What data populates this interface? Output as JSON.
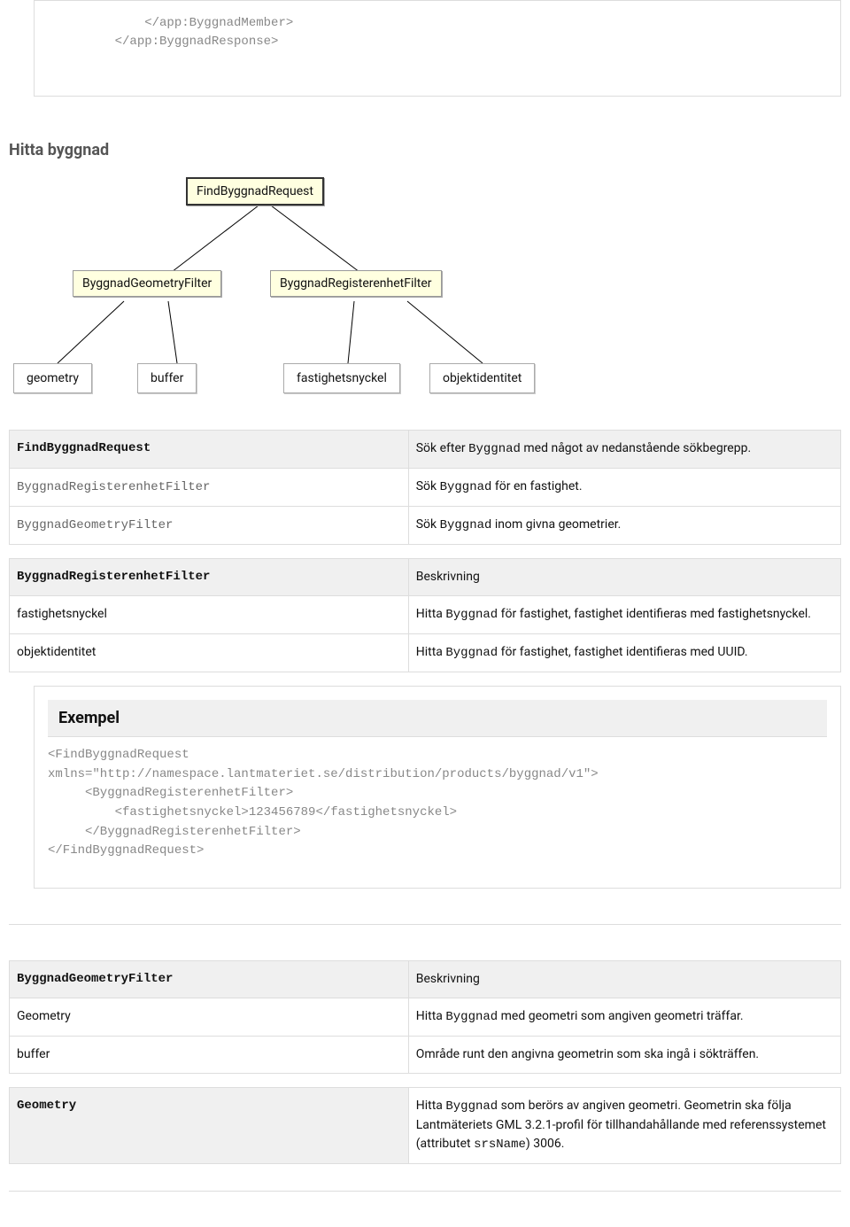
{
  "topCode": "             </app:ByggnadMember>\n         </app:ByggnadResponse>",
  "section_title": "Hitta byggnad",
  "diagram": {
    "root": "FindByggnadRequest",
    "mid_left": "ByggnadGeometryFilter",
    "mid_right": "ByggnadRegisterenhetFilter",
    "leaf1": "geometry",
    "leaf2": "buffer",
    "leaf3": "fastighetsnyckel",
    "leaf4": "objektidentitet"
  },
  "table1": {
    "head_left": "FindByggnadRequest",
    "head_right_pre": "Sök efter ",
    "head_right_code": "Byggnad",
    "head_right_post": " med något av nedanstående sökbegrepp.",
    "r1_left": "ByggnadRegisterenhetFilter",
    "r1_right_pre": "Sök ",
    "r1_right_code": "Byggnad",
    "r1_right_post": " för en fastighet.",
    "r2_left": "ByggnadGeometryFilter",
    "r2_right_pre": "Sök ",
    "r2_right_code": "Byggnad",
    "r2_right_post": " inom givna geometrier."
  },
  "table2": {
    "head_left": "ByggnadRegisterenhetFilter",
    "head_right": "Beskrivning",
    "r1_left": "fastighetsnyckel",
    "r1_right_pre": "Hitta ",
    "r1_right_code": "Byggnad",
    "r1_right_post": " för fastighet, fastighet identifieras med fastighetsnyckel.",
    "r2_left": "objektidentitet",
    "r2_right_pre": "Hitta ",
    "r2_right_code": "Byggnad",
    "r2_right_post": " för fastighet, fastighet identifieras med UUID."
  },
  "example": {
    "title": "Exempel",
    "code": "<FindByggnadRequest\nxmlns=\"http://namespace.lantmateriet.se/distribution/products/byggnad/v1\">\n     <ByggnadRegisterenhetFilter>\n         <fastighetsnyckel>123456789</fastighetsnyckel>\n     </ByggnadRegisterenhetFilter>\n</FindByggnadRequest>"
  },
  "table3": {
    "head_left": "ByggnadGeometryFilter",
    "head_right": "Beskrivning",
    "r1_left": "Geometry",
    "r1_right_pre": "Hitta ",
    "r1_right_code": "Byggnad",
    "r1_right_post": " med geometri som angiven geometri träffar.",
    "r2_left": "buffer",
    "r2_right": "Område runt den angivna geometrin som ska ingå i sökträffen."
  },
  "table4": {
    "head_left": "Geometry",
    "r_pre": "Hitta ",
    "r_code": "Byggnad",
    "r_mid": " som berörs av angiven geometri. Geometrin ska följa Lantmäteriets GML 3.2.1-profil för tillhandahållande med referenssystemet (attributet ",
    "r_code2": "srsName",
    "r_post": ") 3006."
  }
}
